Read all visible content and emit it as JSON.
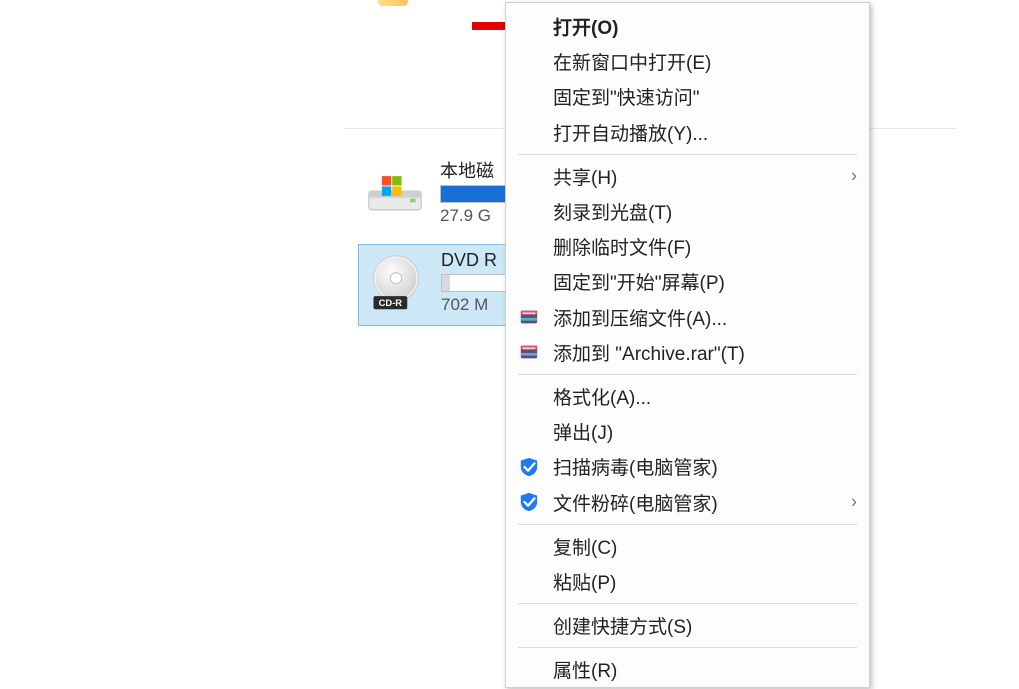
{
  "drives": {
    "c": {
      "label": "本地磁",
      "sub": "27.9 G",
      "fill_color": "#1a6fd6",
      "fill_pct": 98
    },
    "dvd": {
      "label": "DVD R",
      "sub": "702 M",
      "badge": "CD-R",
      "fill_color": "#d9d9d9",
      "fill_pct": 5
    }
  },
  "menu": [
    {
      "label": "打开(O)",
      "bold": true
    },
    {
      "label": "在新窗口中打开(E)"
    },
    {
      "label": "固定到\"快速访问\""
    },
    {
      "label": "打开自动播放(Y)..."
    },
    {
      "sep": true
    },
    {
      "label": "共享(H)",
      "submenu": true
    },
    {
      "label": "刻录到光盘(T)"
    },
    {
      "label": "删除临时文件(F)"
    },
    {
      "label": "固定到\"开始\"屏幕(P)"
    },
    {
      "label": "添加到压缩文件(A)...",
      "icon": "winrar"
    },
    {
      "label": "添加到 \"Archive.rar\"(T)",
      "icon": "winrar"
    },
    {
      "sep": true
    },
    {
      "label": "格式化(A)..."
    },
    {
      "label": "弹出(J)"
    },
    {
      "label": "扫描病毒(电脑管家)",
      "icon": "tencent"
    },
    {
      "label": "文件粉碎(电脑管家)",
      "icon": "tencent",
      "submenu": true
    },
    {
      "sep": true
    },
    {
      "label": "复制(C)"
    },
    {
      "label": "粘贴(P)"
    },
    {
      "sep": true
    },
    {
      "label": "创建快捷方式(S)"
    },
    {
      "sep": true
    },
    {
      "label": "属性(R)"
    }
  ]
}
